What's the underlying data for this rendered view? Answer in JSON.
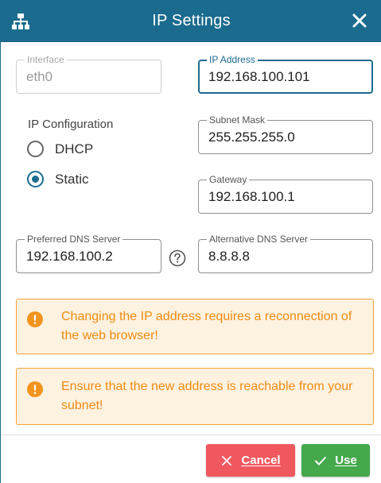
{
  "dialog": {
    "title": "IP Settings",
    "title_icon": "network-icon",
    "close_icon": "close-icon",
    "accent_color": "#1a6b8e"
  },
  "fields": {
    "interface": {
      "label": "Interface",
      "value": "eth0",
      "disabled": true
    },
    "ip_address": {
      "label": "IP Address",
      "value": "192.168.100.101",
      "focused": true
    },
    "subnet_mask": {
      "label": "Subnet Mask",
      "value": "255.255.255.0"
    },
    "gateway": {
      "label": "Gateway",
      "value": "192.168.100.1"
    },
    "preferred_dns": {
      "label": "Preferred DNS Server",
      "value": "192.168.100.2"
    },
    "alternative_dns": {
      "label": "Alternative DNS Server",
      "value": "8.8.8.8"
    }
  },
  "ip_configuration": {
    "label": "IP Configuration",
    "options": [
      {
        "label": "DHCP",
        "checked": false
      },
      {
        "label": "Static",
        "checked": true
      }
    ],
    "selected": "Static"
  },
  "help_icon": "question-circle-icon",
  "alerts": [
    {
      "icon": "info-circle-icon",
      "text": "Changing the IP address requires a reconnection of the web browser!"
    },
    {
      "icon": "info-circle-icon",
      "text": "Ensure that the new address is reachable from your subnet!"
    }
  ],
  "alert_color": "#ee8c10",
  "buttons": {
    "cancel": {
      "label": "Cancel",
      "icon": "close-icon",
      "color": "#f0585f"
    },
    "use": {
      "label": "Use",
      "icon": "check-icon",
      "color": "#45a94b"
    }
  }
}
